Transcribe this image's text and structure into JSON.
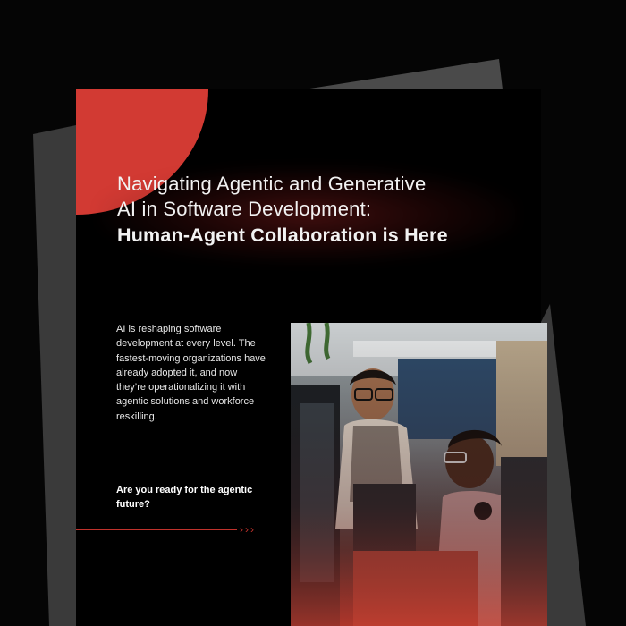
{
  "hero": {
    "title_line1": "Navigating Agentic and Generative",
    "title_line2": "AI in Software Development:",
    "title_bold": "Human-Agent Collaboration is Here"
  },
  "intro": {
    "text": "AI is reshaping software development at every level. The fastest-moving organizations have already adopted it, and now they’re operationalizing it with agentic solutions and workforce reskilling."
  },
  "cta": {
    "question": "Are you ready for the agentic future?",
    "arrow": "›››"
  },
  "colors": {
    "accent": "#d23a33",
    "background": "#000000",
    "paper_gray": "#3a3a3a"
  }
}
